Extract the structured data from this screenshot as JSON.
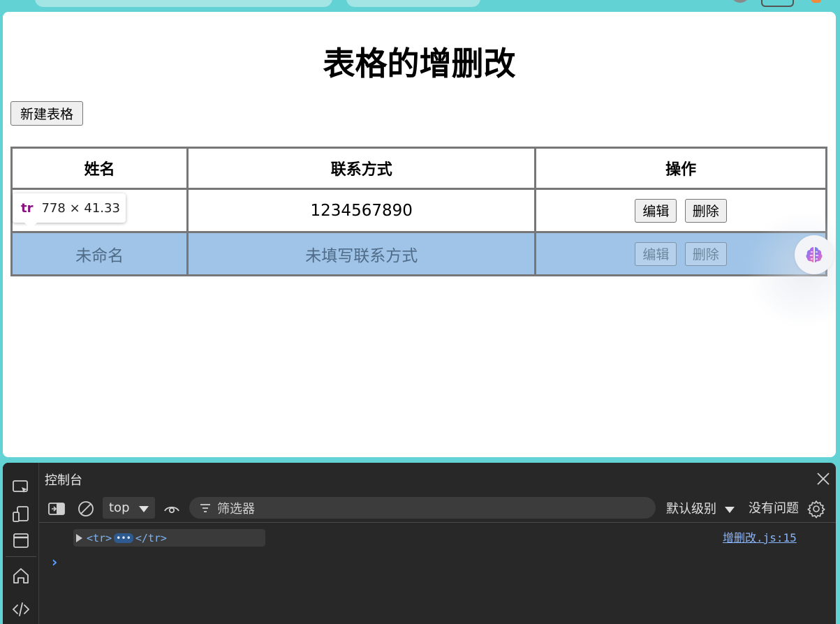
{
  "page": {
    "title": "表格的增删改",
    "new_button": "新建表格"
  },
  "table": {
    "headers": [
      "姓名",
      "联系方式",
      "操作"
    ],
    "rows": [
      {
        "name": "",
        "contact": "1234567890",
        "edit": "编辑",
        "delete": "删除"
      },
      {
        "name": "未命名",
        "contact": "未填写联系方式",
        "edit": "编辑",
        "delete": "删除"
      }
    ]
  },
  "inspect_tooltip": {
    "tag": "tr",
    "dimensions": "778 × 41.33"
  },
  "devtools": {
    "panel_title": "控制台",
    "context": "top",
    "filter_placeholder": "筛选器",
    "level": "默认级别",
    "issues": "没有问题",
    "log_entry": {
      "open_tag": "<tr>",
      "ellipsis": "•••",
      "close_tag": "</tr>",
      "source": "增删改.js:15"
    },
    "prompt": "›"
  },
  "colors": {
    "page_bg": "#62d2d4",
    "highlight_row": "#9fc4e7",
    "devtools_bg": "#282828"
  }
}
